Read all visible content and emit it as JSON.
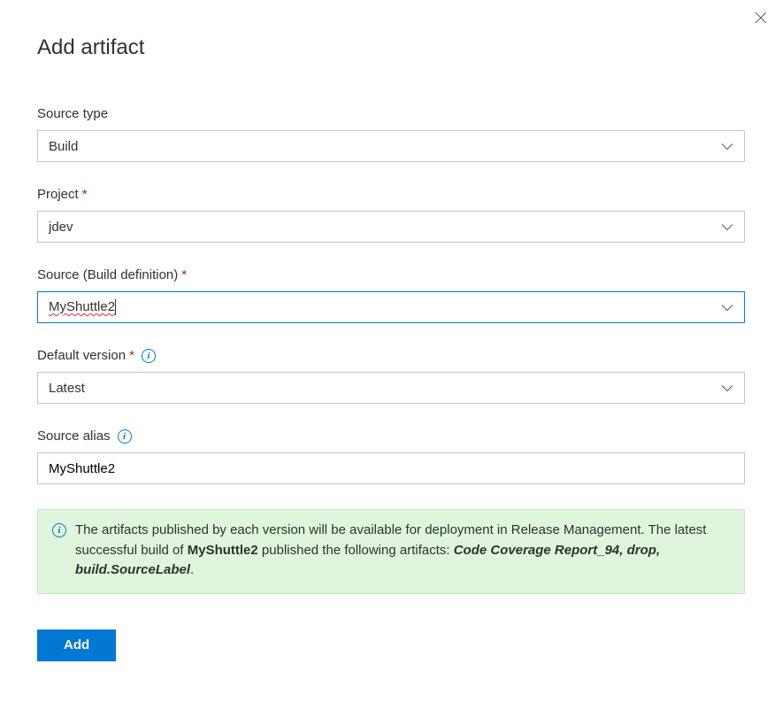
{
  "title": "Add artifact",
  "fields": {
    "source_type": {
      "label": "Source type",
      "value": "Build",
      "required": false
    },
    "project": {
      "label": "Project",
      "value": "jdev",
      "required": true
    },
    "source_build_def": {
      "label": "Source (Build definition)",
      "value": "MyShuttle2",
      "required": true
    },
    "default_version": {
      "label": "Default version",
      "value": "Latest",
      "required": true
    },
    "source_alias": {
      "label": "Source alias",
      "value": "MyShuttle2",
      "required": false
    }
  },
  "info": {
    "text_prefix": "The artifacts published by each version will be available for deployment in Release Management. The latest successful build of ",
    "build_name": "MyShuttle2",
    "text_middle": " published the following artifacts: ",
    "artifacts": "Code Coverage Report_94, drop, build.SourceLabel",
    "text_suffix": "."
  },
  "buttons": {
    "add": "Add"
  }
}
